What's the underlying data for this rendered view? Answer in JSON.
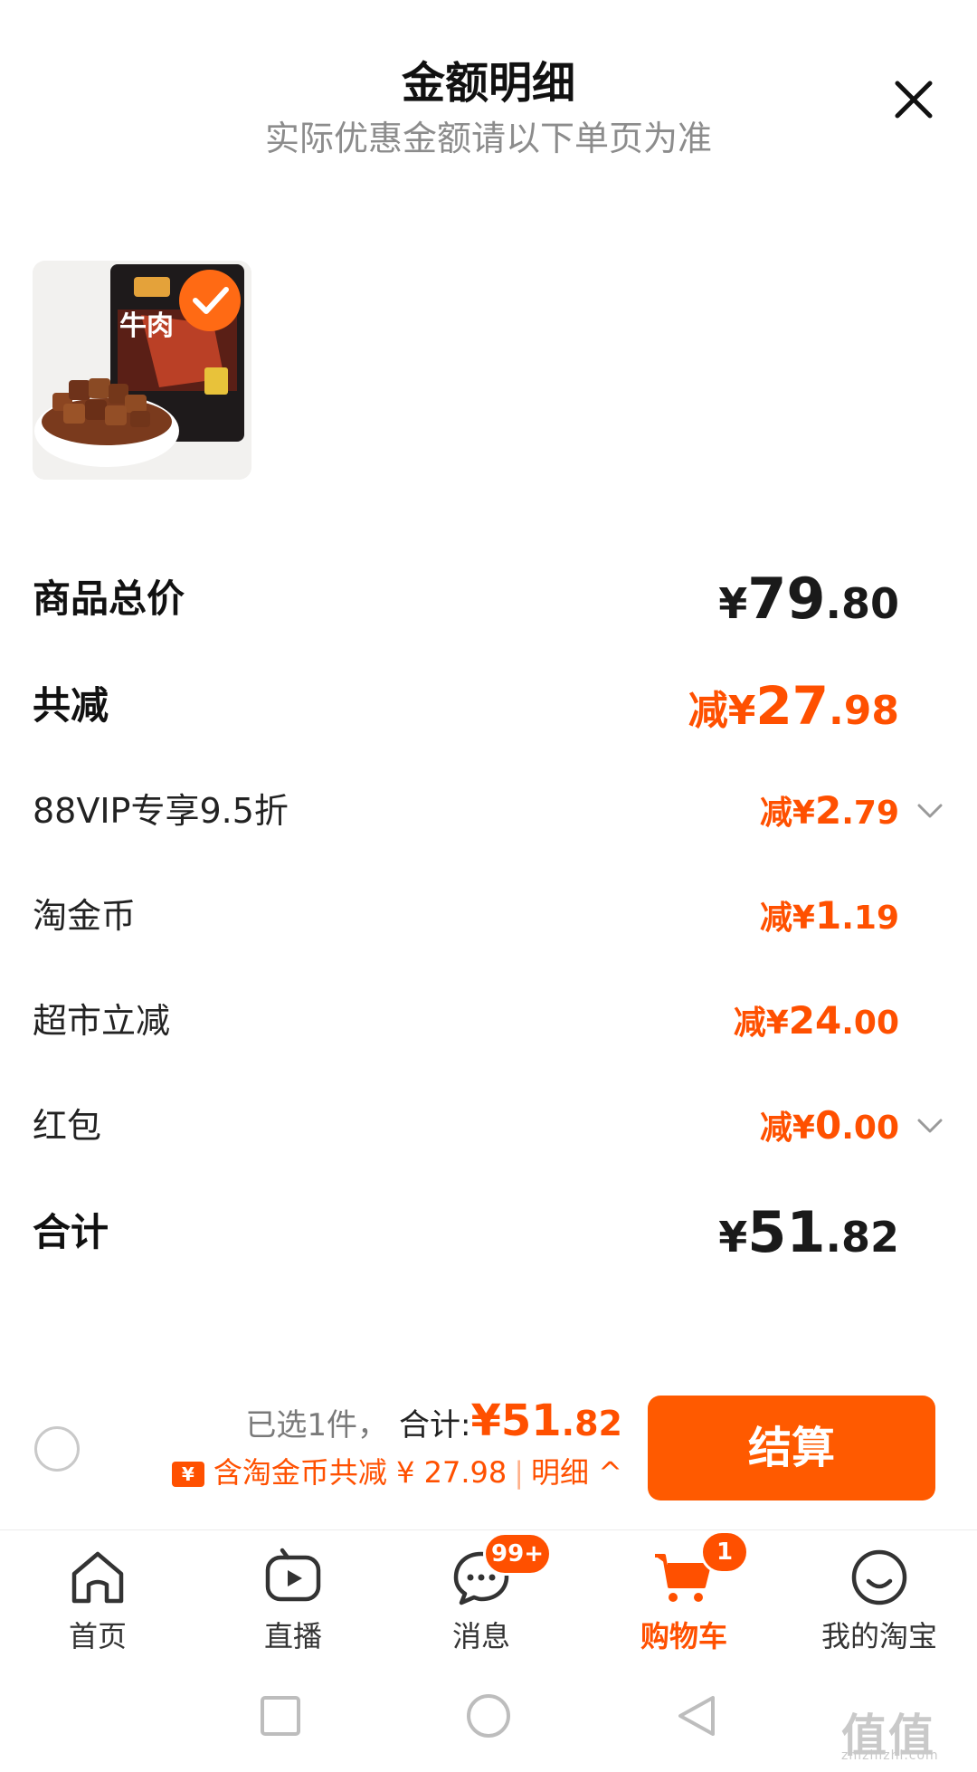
{
  "header": {
    "title": "金额明细",
    "subtitle": "实际优惠金额请以下单页为准",
    "close_icon": "close-icon"
  },
  "product": {
    "image_icon": "beef-jerky-package-image",
    "package_text": "牛肉",
    "selected": true
  },
  "rows": {
    "total_price": {
      "label": "商品总价",
      "symbol": "¥",
      "int": "79",
      "dec": ".80"
    },
    "total_discount": {
      "label": "共减",
      "prefix": "减¥",
      "int": "27",
      "dec": ".98"
    },
    "vip": {
      "label": "88VIP专享9.5折",
      "prefix": "减¥",
      "int": "2",
      "dec": ".79",
      "chevron": "chevron-down-icon"
    },
    "coin": {
      "label": "淘金币",
      "prefix": "减¥",
      "int": "1",
      "dec": ".19"
    },
    "supermarket": {
      "label": "超市立减",
      "prefix": "减¥",
      "int": "24",
      "dec": ".00"
    },
    "redpacket": {
      "label": "红包",
      "prefix": "减¥",
      "int": "0",
      "dec": ".00",
      "chevron": "chevron-down-icon"
    },
    "sum": {
      "label": "合计",
      "symbol": "¥",
      "int": "51",
      "dec": ".82"
    }
  },
  "bottom_bar": {
    "selected_text": "已选1件，",
    "total_label": "合计:",
    "total_int": "¥51",
    "total_dec": ".82",
    "coin_text": "含淘金币共减 ¥ 27.98",
    "separator": "|",
    "detail_text": "明细 ^",
    "checkout_label": "结算"
  },
  "tabbar": {
    "items": [
      {
        "label": "首页",
        "icon": "home-icon"
      },
      {
        "label": "直播",
        "icon": "live-play-icon"
      },
      {
        "label": "消息",
        "icon": "message-icon",
        "badge": "99+"
      },
      {
        "label": "购物车",
        "icon": "cart-icon",
        "badge": "1",
        "active": true
      },
      {
        "label": "我的淘宝",
        "icon": "smiley-icon"
      }
    ]
  },
  "watermark": {
    "main": "值值值",
    "sub": "zhizhizhi.com"
  },
  "colors": {
    "accent": "#ff5000",
    "checkout": "#ff5a00",
    "muted": "#8c8c8c"
  }
}
